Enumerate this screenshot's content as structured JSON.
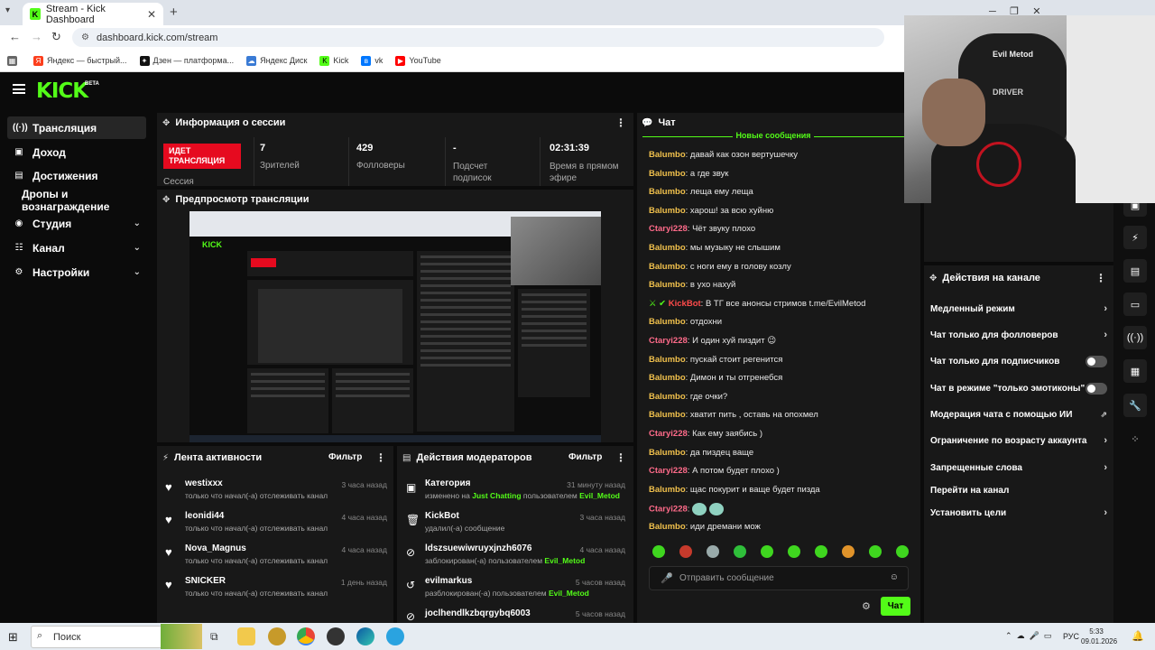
{
  "browser": {
    "tab_title": "Stream - Kick Dashboard",
    "url": "dashboard.kick.com/stream",
    "bookmarks": [
      "Яндекс — быстрый...",
      "Дзен — платформа...",
      "Яндекс Диск",
      "Kick",
      "vk",
      "YouTube"
    ]
  },
  "header": {
    "logo": "KICK",
    "beta": "BETA"
  },
  "sidebar": {
    "items": [
      {
        "label": "Трансляция",
        "icon": "broadcast-icon"
      },
      {
        "label": "Доход",
        "icon": "revenue-icon"
      },
      {
        "label": "Достижения",
        "icon": "achievements-icon"
      },
      {
        "label": "Дропы и вознаграждение",
        "icon": ""
      },
      {
        "label": "Студия",
        "icon": "studio-icon"
      },
      {
        "label": "Канал",
        "icon": "channel-icon"
      },
      {
        "label": "Настройки",
        "icon": "gear-icon"
      }
    ]
  },
  "session": {
    "title": "Информация о сессии",
    "live_badge": "ИДЕТ ТРАНСЛЯЦИЯ",
    "session_label": "Сессия",
    "stats": [
      {
        "value": "7",
        "label": "Зрителей"
      },
      {
        "value": "429",
        "label": "Фолловеры"
      },
      {
        "value": "-",
        "label": "Подсчет подписок"
      },
      {
        "value": "02:31:39",
        "label": "Время в прямом эфире"
      }
    ]
  },
  "preview": {
    "title": "Предпросмотр трансляции"
  },
  "activity": {
    "title": "Лента активности",
    "filter": "Фильтр",
    "items": [
      {
        "user": "westixxx",
        "text": "только что начал(-а) отслеживать канал",
        "time": "3 часа назад"
      },
      {
        "user": "leonidi44",
        "text": "только что начал(-а) отслеживать канал",
        "time": "4 часа назад"
      },
      {
        "user": "Nova_Magnus",
        "text": "только что начал(-а) отслеживать канал",
        "time": "4 часа назад"
      },
      {
        "user": "SNICKER",
        "text": "только что начал(-а) отслеживать канал",
        "time": "1 день назад"
      }
    ]
  },
  "mod_actions": {
    "title": "Действия модераторов",
    "filter": "Фильтр",
    "items": [
      {
        "title": "Категория",
        "pre": "изменено на",
        "green1": "Just Chatting",
        "mid": "пользователем",
        "green2": "Evil_Metod",
        "time": "31 минуту назад",
        "icon": "category-icon"
      },
      {
        "title": "KickBot",
        "pre": "удалил(-а) сообщение",
        "green1": "",
        "mid": "",
        "green2": "",
        "time": "3 часа назад",
        "icon": "trash-icon"
      },
      {
        "title": "ldszsuewiwruyxjnzh6076",
        "pre": "заблокирован(-а) пользователем",
        "green1": "",
        "mid": "",
        "green2": "Evil_Metod",
        "time": "4 часа назад",
        "icon": "ban-icon"
      },
      {
        "title": "evilmarkus",
        "pre": "разблокирован(-а) пользователем",
        "green1": "",
        "mid": "",
        "green2": "Evil_Metod",
        "time": "5 часов назад",
        "icon": "unban-icon"
      },
      {
        "title": "joclhendlkzbqrgybq6003",
        "pre": "",
        "green1": "",
        "mid": "",
        "green2": "",
        "time": "5 часов назад",
        "icon": "ban-icon"
      }
    ]
  },
  "chat": {
    "title": "Чат",
    "new_messages": "Новые сообщения",
    "placeholder": "Отправить сообщение",
    "send": "Чат",
    "messages": [
      {
        "user": "Balumbo",
        "text": "давай как озон вертушечку",
        "color": "u1"
      },
      {
        "user": "Balumbo",
        "text": "а где звук",
        "color": "u1"
      },
      {
        "user": "Balumbo",
        "text": "леща ему леща",
        "color": "u1"
      },
      {
        "user": "Balumbo",
        "text": "харош! за всю хуйню",
        "color": "u1"
      },
      {
        "user": "Ctaryi228",
        "text": "Чёт звуку плохо",
        "color": "u2"
      },
      {
        "user": "Balumbo",
        "text": "мы музыку не слышим",
        "color": "u1"
      },
      {
        "user": "Balumbo",
        "text": "с ноги ему в голову козлу",
        "color": "u1"
      },
      {
        "user": "Balumbo",
        "text": "в ухо нахуй",
        "color": "u1"
      },
      {
        "user": "KickBot",
        "text": "В ТГ все анонсы стримов t.me/EvilMetod",
        "color": "u3"
      },
      {
        "user": "Balumbo",
        "text": "отдохни",
        "color": "u1"
      },
      {
        "user": "Ctaryi228",
        "text": "И один хуй пиздит 😉",
        "color": "u2"
      },
      {
        "user": "Balumbo",
        "text": "пускай стоит регенится",
        "color": "u1"
      },
      {
        "user": "Balumbo",
        "text": "Димон и ты отгренебся",
        "color": "u1"
      },
      {
        "user": "Balumbo",
        "text": "где очки?",
        "color": "u1"
      },
      {
        "user": "Balumbo",
        "text": "хватит пить , оставь на опохмел",
        "color": "u1"
      },
      {
        "user": "Ctaryi228",
        "text": "Как ему заябись )",
        "color": "u2"
      },
      {
        "user": "Balumbo",
        "text": "да пиздец ваще",
        "color": "u1"
      },
      {
        "user": "Ctaryi228",
        "text": "А потом будет плохо )",
        "color": "u2"
      },
      {
        "user": "Balumbo",
        "text": "щас покурит и ваще будет пизда",
        "color": "u1"
      },
      {
        "user": "Ctaryi228",
        "text": "",
        "color": "u2"
      },
      {
        "user": "Balumbo",
        "text": "иди дремани мож",
        "color": "u1"
      }
    ]
  },
  "channel_actions": {
    "title": "Действия на канале",
    "items": [
      {
        "label": "Медленный режим",
        "end": "chevron"
      },
      {
        "label": "Чат только для фолловеров",
        "end": "chevron"
      },
      {
        "label": "Чат только для подписчиков",
        "end": "toggle"
      },
      {
        "label": "Чат в режиме \"только эмотиконы\"",
        "end": "toggle"
      },
      {
        "label": "Модерация чата с помощью ИИ",
        "end": "external"
      },
      {
        "label": "Ограничение по возрасту аккаунта",
        "end": "chevron"
      },
      {
        "label": "Запрещенные слова",
        "end": "chevron"
      },
      {
        "label": "Перейти на канал",
        "end": "none"
      },
      {
        "label": "Установить цели",
        "end": "chevron"
      }
    ]
  },
  "webcam": {
    "watermark": "Evil Metod",
    "chair": "DRIVER"
  },
  "taskbar": {
    "search": "Поиск",
    "lang": "РУС",
    "time": "5:33",
    "date": "09.01.2026"
  },
  "colors": {
    "accent": "#53fc18",
    "live": "#e60a1f",
    "panel": "#181818"
  }
}
